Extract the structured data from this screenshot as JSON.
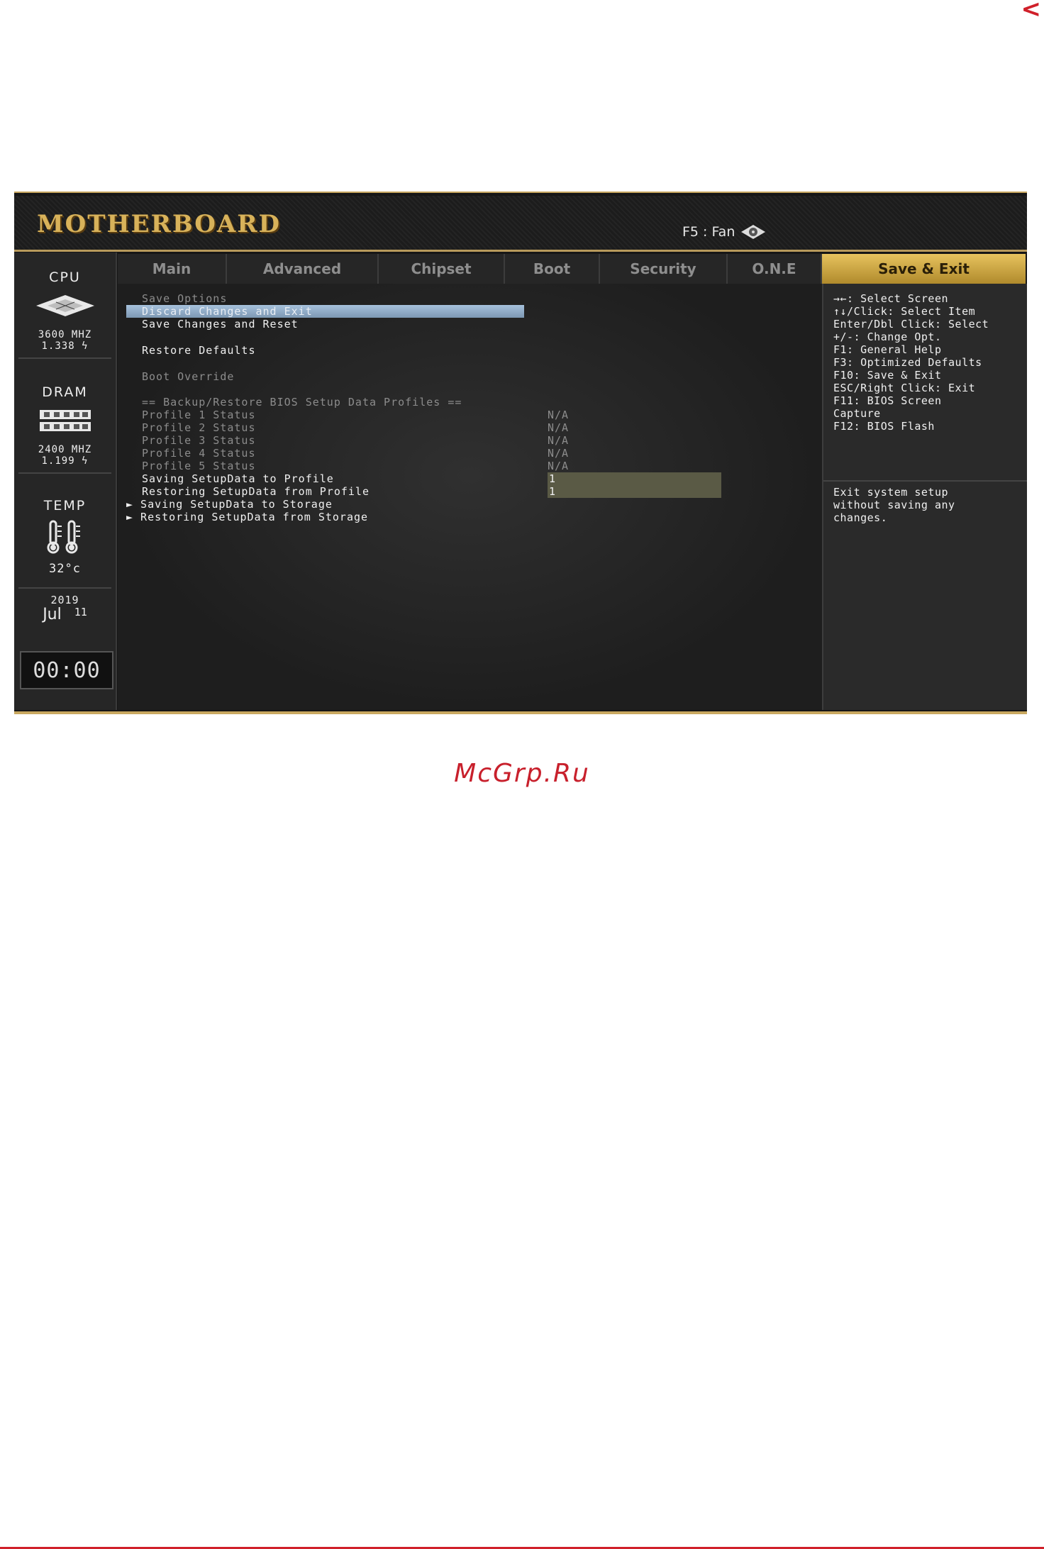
{
  "nav": {
    "back_label": "<"
  },
  "header": {
    "logo": "MOTHERBOARD",
    "fan_shortcut": "F5 : Fan"
  },
  "left_panel": {
    "cpu": {
      "title": "CPU",
      "freq": "3600 MHZ",
      "volt": "1.338 ϟ"
    },
    "dram": {
      "title": "DRAM",
      "freq": "2400 MHZ",
      "volt": "1.199 ϟ"
    },
    "temp": {
      "title": "TEMP",
      "value": "32°c"
    },
    "date": {
      "year": "2019",
      "month": "Jul",
      "day": "11"
    },
    "clock": "00:00"
  },
  "tabs": [
    {
      "label": "Main",
      "active": false
    },
    {
      "label": "Advanced",
      "active": false
    },
    {
      "label": "Chipset",
      "active": false
    },
    {
      "label": "Boot",
      "active": false
    },
    {
      "label": "Security",
      "active": false
    },
    {
      "label": "O.N.E",
      "active": false
    },
    {
      "label": "Save & Exit",
      "active": true
    }
  ],
  "main": {
    "items": {
      "save_options": "Save Options",
      "discard_exit": "Discard Changes and Exit",
      "save_reset": "Save Changes and Reset",
      "restore_defaults": "Restore Defaults",
      "boot_override": "Boot Override",
      "backup_header": "== Backup/Restore BIOS Setup Data Profiles ==",
      "profile1": "Profile 1 Status",
      "profile2": "Profile 2 Status",
      "profile3": "Profile 3 Status",
      "profile4": "Profile 4 Status",
      "profile5": "Profile 5 Status",
      "saving_profile": "Saving SetupData to Profile",
      "restoring_profile": "Restoring SetupData from Profile",
      "saving_storage": "► Saving SetupData to Storage",
      "restoring_storage": "► Restoring SetupData from Storage"
    },
    "values": {
      "profile1": "N/A",
      "profile2": "N/A",
      "profile3": "N/A",
      "profile4": "N/A",
      "profile5": "N/A",
      "saving_profile": "1",
      "restoring_profile": "1"
    }
  },
  "help": {
    "keys": [
      "→←: Select Screen",
      "↑↓/Click: Select Item",
      "Enter/Dbl Click: Select",
      "+/-: Change Opt.",
      "F1: General Help",
      "F3: Optimized Defaults",
      "F10: Save & Exit",
      "ESC/Right Click: Exit",
      "F11: BIOS Screen",
      "Capture",
      "F12: BIOS Flash"
    ],
    "description": [
      "Exit system setup",
      "without saving any",
      "changes."
    ]
  },
  "footer": {
    "watermark": "McGrp.Ru"
  },
  "colors": {
    "accent_gold": "#c9a860",
    "active_tab": "#d8b44a",
    "selection": "#8fabc7",
    "watermark_red": "#c8202c"
  }
}
